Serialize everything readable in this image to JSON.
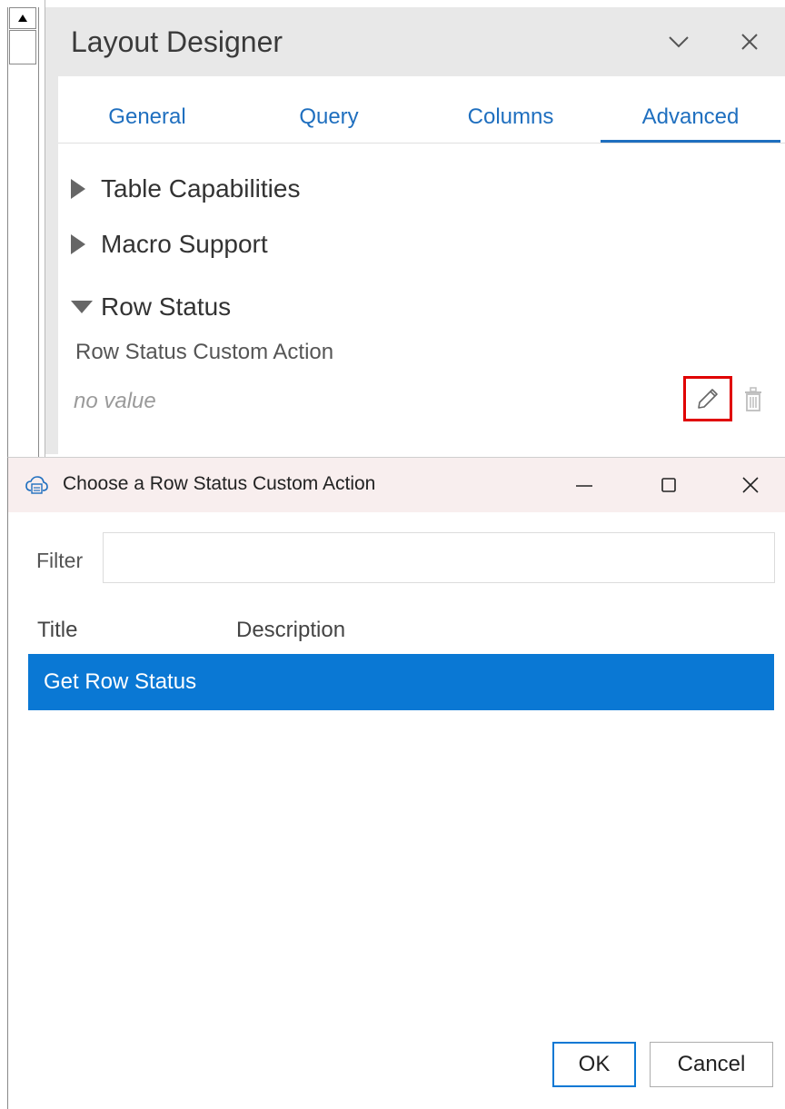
{
  "designer": {
    "title": "Layout Designer",
    "tabs": [
      {
        "label": "General",
        "active": false
      },
      {
        "label": "Query",
        "active": false
      },
      {
        "label": "Columns",
        "active": false
      },
      {
        "label": "Advanced",
        "active": true
      }
    ],
    "sections": [
      {
        "label": "Table Capabilities",
        "expanded": false
      },
      {
        "label": "Macro Support",
        "expanded": false
      },
      {
        "label": "Row Status",
        "expanded": true
      }
    ],
    "field": {
      "label": "Row Status Custom Action",
      "value": "no value"
    }
  },
  "dialog": {
    "title": "Choose a Row Status Custom Action",
    "filter_label": "Filter",
    "filter_value": "",
    "columns": [
      "Title",
      "Description"
    ],
    "rows": [
      {
        "title": "Get Row Status",
        "description": "",
        "selected": true
      }
    ],
    "ok_label": "OK",
    "cancel_label": "Cancel"
  },
  "colors": {
    "accent": "#0a78d4",
    "tab_accent": "#1f6fbf",
    "highlight_border": "#e00000",
    "titlebar_bg": "#f8eeee"
  }
}
